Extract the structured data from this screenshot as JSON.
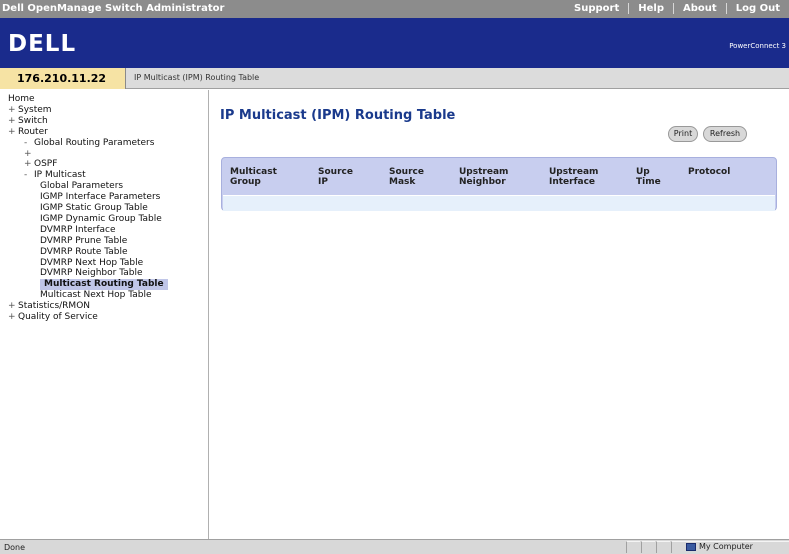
{
  "app_title": "Dell OpenManage Switch Administrator",
  "top_links": [
    "Support",
    "Help",
    "About",
    "Log Out"
  ],
  "brand": {
    "logo": "DELL",
    "product_name": "PowerConnect 3"
  },
  "device_ip": "176.210.11.22",
  "breadcrumb": "IP Multicast (IPM) Routing Table",
  "tree": [
    {
      "prefix": "",
      "label": "Home"
    },
    {
      "prefix": "+",
      "label": "System"
    },
    {
      "prefix": "+",
      "label": "Switch"
    },
    {
      "prefix": "+",
      "label": "Router"
    },
    {
      "prefix": "-",
      "label": "Global Routing Parameters"
    },
    {
      "prefix": "+",
      "label": ""
    },
    {
      "prefix": "+",
      "label": "OSPF"
    },
    {
      "prefix": "-",
      "label": "IP Multicast"
    },
    {
      "prefix": "",
      "label": "Global Parameters"
    },
    {
      "prefix": "",
      "label": "IGMP Interface Parameters"
    },
    {
      "prefix": "",
      "label": "IGMP Static Group Table"
    },
    {
      "prefix": "",
      "label": "IGMP Dynamic Group Table"
    },
    {
      "prefix": "",
      "label": "DVMRP Interface"
    },
    {
      "prefix": "",
      "label": "DVMRP Prune Table"
    },
    {
      "prefix": "",
      "label": "DVMRP Route Table"
    },
    {
      "prefix": "",
      "label": "DVMRP Next Hop Table"
    },
    {
      "prefix": "",
      "label": "DVMRP Neighbor Table"
    },
    {
      "prefix": "",
      "label": "Multicast Routing Table"
    },
    {
      "prefix": "",
      "label": "Multicast Next Hop Table"
    },
    {
      "prefix": "+",
      "label": "Statistics/RMON"
    },
    {
      "prefix": "+",
      "label": "Quality of Service"
    }
  ],
  "selected_item": "Multicast Routing Table",
  "main": {
    "title": "IP Multicast (IPM) Routing Table",
    "print_label": "Print",
    "refresh_label": "Refresh",
    "columns": [
      [
        "Multicast",
        "Group"
      ],
      [
        "Source",
        "IP"
      ],
      [
        "Source",
        "Mask"
      ],
      [
        "Upstream",
        "Neighbor"
      ],
      [
        "Upstream",
        "Interface"
      ],
      [
        "Up",
        "Time"
      ],
      [
        "Protocol",
        ""
      ]
    ]
  },
  "status": {
    "text": "Done",
    "zone": "My Computer"
  }
}
